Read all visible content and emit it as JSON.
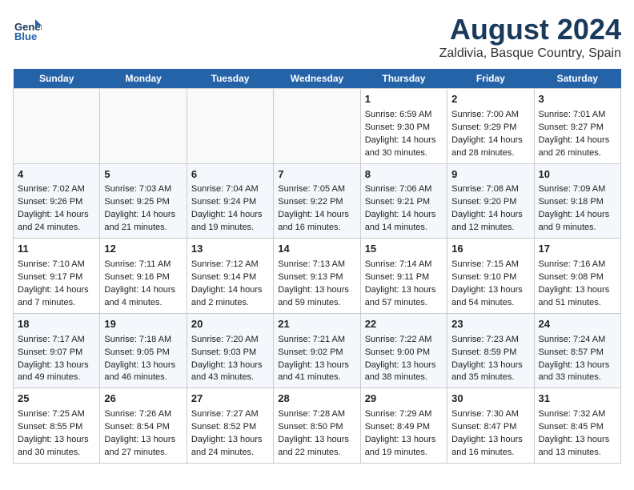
{
  "header": {
    "logo_line1": "General",
    "logo_line2": "Blue",
    "main_title": "August 2024",
    "subtitle": "Zaldivia, Basque Country, Spain"
  },
  "days_of_week": [
    "Sunday",
    "Monday",
    "Tuesday",
    "Wednesday",
    "Thursday",
    "Friday",
    "Saturday"
  ],
  "weeks": [
    [
      {
        "day": null
      },
      {
        "day": null
      },
      {
        "day": null
      },
      {
        "day": null
      },
      {
        "day": 1,
        "sunrise": "Sunrise: 6:59 AM",
        "sunset": "Sunset: 9:30 PM",
        "daylight": "Daylight: 14 hours and 30 minutes."
      },
      {
        "day": 2,
        "sunrise": "Sunrise: 7:00 AM",
        "sunset": "Sunset: 9:29 PM",
        "daylight": "Daylight: 14 hours and 28 minutes."
      },
      {
        "day": 3,
        "sunrise": "Sunrise: 7:01 AM",
        "sunset": "Sunset: 9:27 PM",
        "daylight": "Daylight: 14 hours and 26 minutes."
      }
    ],
    [
      {
        "day": 4,
        "sunrise": "Sunrise: 7:02 AM",
        "sunset": "Sunset: 9:26 PM",
        "daylight": "Daylight: 14 hours and 24 minutes."
      },
      {
        "day": 5,
        "sunrise": "Sunrise: 7:03 AM",
        "sunset": "Sunset: 9:25 PM",
        "daylight": "Daylight: 14 hours and 21 minutes."
      },
      {
        "day": 6,
        "sunrise": "Sunrise: 7:04 AM",
        "sunset": "Sunset: 9:24 PM",
        "daylight": "Daylight: 14 hours and 19 minutes."
      },
      {
        "day": 7,
        "sunrise": "Sunrise: 7:05 AM",
        "sunset": "Sunset: 9:22 PM",
        "daylight": "Daylight: 14 hours and 16 minutes."
      },
      {
        "day": 8,
        "sunrise": "Sunrise: 7:06 AM",
        "sunset": "Sunset: 9:21 PM",
        "daylight": "Daylight: 14 hours and 14 minutes."
      },
      {
        "day": 9,
        "sunrise": "Sunrise: 7:08 AM",
        "sunset": "Sunset: 9:20 PM",
        "daylight": "Daylight: 14 hours and 12 minutes."
      },
      {
        "day": 10,
        "sunrise": "Sunrise: 7:09 AM",
        "sunset": "Sunset: 9:18 PM",
        "daylight": "Daylight: 14 hours and 9 minutes."
      }
    ],
    [
      {
        "day": 11,
        "sunrise": "Sunrise: 7:10 AM",
        "sunset": "Sunset: 9:17 PM",
        "daylight": "Daylight: 14 hours and 7 minutes."
      },
      {
        "day": 12,
        "sunrise": "Sunrise: 7:11 AM",
        "sunset": "Sunset: 9:16 PM",
        "daylight": "Daylight: 14 hours and 4 minutes."
      },
      {
        "day": 13,
        "sunrise": "Sunrise: 7:12 AM",
        "sunset": "Sunset: 9:14 PM",
        "daylight": "Daylight: 14 hours and 2 minutes."
      },
      {
        "day": 14,
        "sunrise": "Sunrise: 7:13 AM",
        "sunset": "Sunset: 9:13 PM",
        "daylight": "Daylight: 13 hours and 59 minutes."
      },
      {
        "day": 15,
        "sunrise": "Sunrise: 7:14 AM",
        "sunset": "Sunset: 9:11 PM",
        "daylight": "Daylight: 13 hours and 57 minutes."
      },
      {
        "day": 16,
        "sunrise": "Sunrise: 7:15 AM",
        "sunset": "Sunset: 9:10 PM",
        "daylight": "Daylight: 13 hours and 54 minutes."
      },
      {
        "day": 17,
        "sunrise": "Sunrise: 7:16 AM",
        "sunset": "Sunset: 9:08 PM",
        "daylight": "Daylight: 13 hours and 51 minutes."
      }
    ],
    [
      {
        "day": 18,
        "sunrise": "Sunrise: 7:17 AM",
        "sunset": "Sunset: 9:07 PM",
        "daylight": "Daylight: 13 hours and 49 minutes."
      },
      {
        "day": 19,
        "sunrise": "Sunrise: 7:18 AM",
        "sunset": "Sunset: 9:05 PM",
        "daylight": "Daylight: 13 hours and 46 minutes."
      },
      {
        "day": 20,
        "sunrise": "Sunrise: 7:20 AM",
        "sunset": "Sunset: 9:03 PM",
        "daylight": "Daylight: 13 hours and 43 minutes."
      },
      {
        "day": 21,
        "sunrise": "Sunrise: 7:21 AM",
        "sunset": "Sunset: 9:02 PM",
        "daylight": "Daylight: 13 hours and 41 minutes."
      },
      {
        "day": 22,
        "sunrise": "Sunrise: 7:22 AM",
        "sunset": "Sunset: 9:00 PM",
        "daylight": "Daylight: 13 hours and 38 minutes."
      },
      {
        "day": 23,
        "sunrise": "Sunrise: 7:23 AM",
        "sunset": "Sunset: 8:59 PM",
        "daylight": "Daylight: 13 hours and 35 minutes."
      },
      {
        "day": 24,
        "sunrise": "Sunrise: 7:24 AM",
        "sunset": "Sunset: 8:57 PM",
        "daylight": "Daylight: 13 hours and 33 minutes."
      }
    ],
    [
      {
        "day": 25,
        "sunrise": "Sunrise: 7:25 AM",
        "sunset": "Sunset: 8:55 PM",
        "daylight": "Daylight: 13 hours and 30 minutes."
      },
      {
        "day": 26,
        "sunrise": "Sunrise: 7:26 AM",
        "sunset": "Sunset: 8:54 PM",
        "daylight": "Daylight: 13 hours and 27 minutes."
      },
      {
        "day": 27,
        "sunrise": "Sunrise: 7:27 AM",
        "sunset": "Sunset: 8:52 PM",
        "daylight": "Daylight: 13 hours and 24 minutes."
      },
      {
        "day": 28,
        "sunrise": "Sunrise: 7:28 AM",
        "sunset": "Sunset: 8:50 PM",
        "daylight": "Daylight: 13 hours and 22 minutes."
      },
      {
        "day": 29,
        "sunrise": "Sunrise: 7:29 AM",
        "sunset": "Sunset: 8:49 PM",
        "daylight": "Daylight: 13 hours and 19 minutes."
      },
      {
        "day": 30,
        "sunrise": "Sunrise: 7:30 AM",
        "sunset": "Sunset: 8:47 PM",
        "daylight": "Daylight: 13 hours and 16 minutes."
      },
      {
        "day": 31,
        "sunrise": "Sunrise: 7:32 AM",
        "sunset": "Sunset: 8:45 PM",
        "daylight": "Daylight: 13 hours and 13 minutes."
      }
    ]
  ]
}
